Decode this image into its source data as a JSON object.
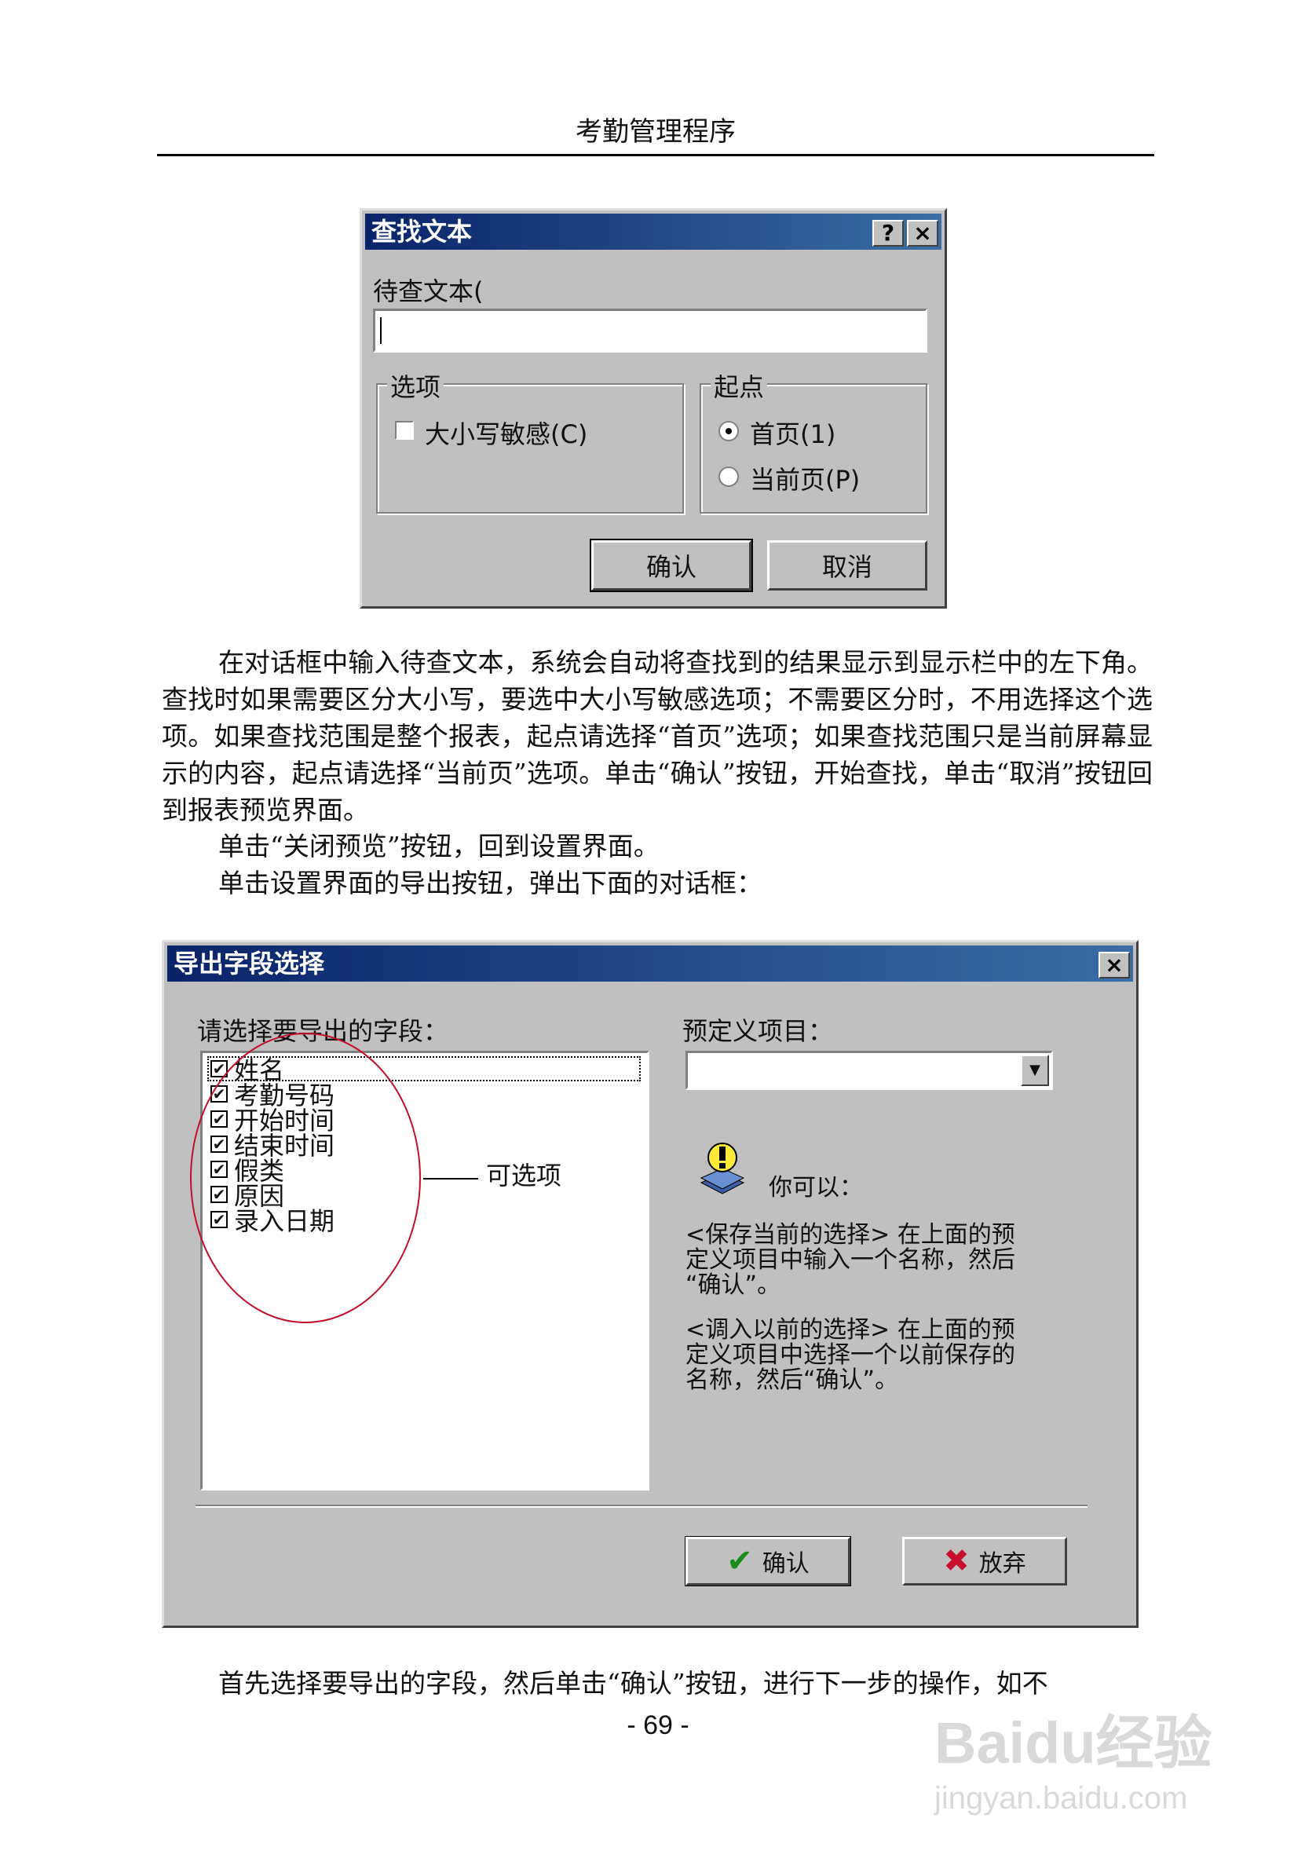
{
  "header": {
    "title": "考勤管理程序"
  },
  "find_dialog": {
    "title": "查找文本",
    "help_button": "?",
    "close_button": "×",
    "search_label": "待查文本(",
    "search_value": "",
    "options_group": "选项",
    "case_sensitive": "大小写敏感(C)",
    "start_group": "起点",
    "first_page": "首页(1)",
    "current_page": "当前页(P)",
    "ok": "确认",
    "cancel": "取消"
  },
  "paragraphs": {
    "p1": "在对话框中输入待查文本，系统会自动将查找到的结果显示到显示栏中的左下角。查找时如果需要区分大小写，要选中大小写敏感选项；不需要区分时，不用选择这个选项。如果查找范围是整个报表，起点请选择“首页”选项；如果查找范围只是当前屏幕显示的内容，起点请选择“当前页”选项。单击“确认”按钮，开始查找，单击“取消”按钮回到报表预览界面。",
    "p2": "单击“关闭预览”按钮，回到设置界面。",
    "p3": "单击设置界面的导出按钮，弹出下面的对话框：",
    "p4": "首先选择要导出的字段，然后单击“确认”按钮，进行下一步的操作，如不"
  },
  "export_dialog": {
    "title": "导出字段选择",
    "close_button": "×",
    "fields_label": "请选择要导出的字段：",
    "fields": [
      "姓名",
      "考勤号码",
      "开始时间",
      "结束时间",
      "假类",
      "原因",
      "录入日期"
    ],
    "annotation": "可选项",
    "predefined_label": "预定义项目：",
    "predefined_value": "",
    "info_title": "你可以：",
    "info_save": "<保存当前的选择> 在上面的预\n定义项目中输入一个名称，然后\n“确认”。",
    "info_load": "<调入以前的选择> 在上面的预\n定义项目中选择一个以前保存的\n名称，然后“确认”。",
    "ok": "确认",
    "discard": "放弃"
  },
  "page_number": "- 69 -",
  "watermark": {
    "brand": "Baidu经验",
    "url": "jingyan.baidu.com"
  }
}
